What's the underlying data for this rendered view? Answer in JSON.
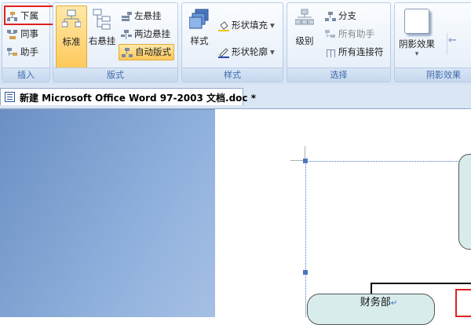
{
  "ribbon": {
    "insert_group": {
      "items": [
        {
          "label": "下属",
          "icon": "subordinate-icon"
        },
        {
          "label": "同事",
          "icon": "coworker-icon"
        },
        {
          "label": "助手",
          "icon": "assistant-icon"
        }
      ],
      "label": "插入"
    },
    "layout_group": {
      "standard_label": "标准",
      "right_hanging_label": "右悬挂",
      "left_hanging_label": "左悬挂",
      "both_hanging_label": "两边悬挂",
      "auto_layout_label": "自动版式",
      "label": "版式"
    },
    "style_group": {
      "style_label": "样式",
      "shape_fill_label": "形状填充",
      "shape_outline_label": "形状轮廓",
      "label": "样式"
    },
    "select_group": {
      "level_label": "级别",
      "branch_label": "分支",
      "all_assistants_label": "所有助手",
      "all_connectors_label": "所有连接符",
      "label": "选择"
    },
    "shadow_group": {
      "shadow_effect_label": "阴影效果",
      "label": "阴影效果"
    }
  },
  "document": {
    "tab_title": "新建 Microsoft Office Word 97-2003 文档.doc *"
  },
  "canvas": {
    "node_label": "财务部"
  },
  "colors": {
    "highlight": "#e02020",
    "node_fill": "#d8ecec",
    "ribbon_accent": "#ffd36b"
  }
}
